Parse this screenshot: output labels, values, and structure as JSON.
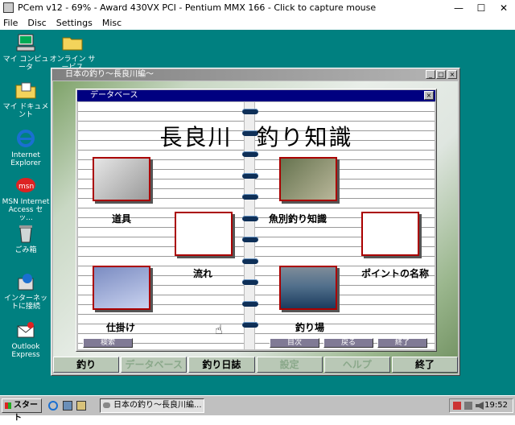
{
  "host": {
    "title": "PCem v12 - 69% - Award 430VX PCI - Pentium MMX 166 - Click to capture mouse",
    "menu": [
      "File",
      "Disc",
      "Settings",
      "Misc"
    ],
    "controls": {
      "minimize": "—",
      "maximize": "☐",
      "close": "✕"
    }
  },
  "desktop": {
    "icons": [
      {
        "label": "マイ コンピュータ"
      },
      {
        "label": "オンライン サービス"
      },
      {
        "label": "マイ ドキュメント"
      },
      {
        "label": "Internet Explorer"
      },
      {
        "label": "MSN Internet Access セッ..."
      },
      {
        "label": "ごみ箱"
      },
      {
        "label": "インターネットに接続"
      },
      {
        "label": "Outlook Express"
      }
    ]
  },
  "app": {
    "title": "日本の釣り～長良川編～",
    "controls": {
      "minimize": "_",
      "maximize": "□",
      "close": "×"
    }
  },
  "dialog": {
    "title": "データベース",
    "close": "×",
    "heading": "長良川　釣り知識",
    "items": {
      "tools": "道具",
      "fish": "魚別釣り知識",
      "flow": "流れ",
      "points": "ポイントの名称",
      "rig": "仕掛け",
      "spot": "釣り場"
    },
    "buttons": {
      "search": "検索",
      "index": "目次",
      "back": "戻る",
      "end": "終了"
    }
  },
  "tabs": [
    "釣り",
    "データベース",
    "釣り日誌",
    "設定",
    "ヘルプ",
    "終了"
  ],
  "taskbar": {
    "start": "スタート",
    "task": "日本の釣り～長良川編...",
    "clock": "19:52"
  }
}
